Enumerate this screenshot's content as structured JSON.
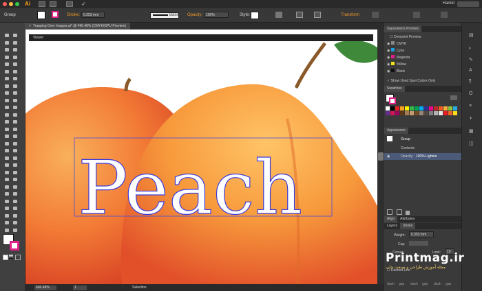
{
  "app": {
    "logo_text": "Ai",
    "user_name": "Hamid"
  },
  "control_bar": {
    "selection_label": "Group",
    "stroke_label": "Stroke:",
    "stroke_value": "0.353 mm",
    "brush_label": "Basic",
    "opacity_label": "Opacity:",
    "opacity_value": "100%",
    "style_label": "Style:",
    "transform_label": "Transform"
  },
  "document": {
    "tab_title": "Trapping Over Images.ai* @ 496.48% (CMYK/GPU Preview)",
    "viewer_label": "Viewer",
    "artwork_text": "Peach"
  },
  "status_bar": {
    "zoom": "496.48%",
    "page": "1",
    "tool": "Selection"
  },
  "separations": {
    "title": "Separations Preview",
    "overprint_label": "Overprint Preview",
    "plates": [
      {
        "name": "CMYK",
        "color": "#888888"
      },
      {
        "name": "Cyan",
        "color": "#1ea0e0"
      },
      {
        "name": "Magenta",
        "color": "#e0208a"
      },
      {
        "name": "Yellow",
        "color": "#f2e21a"
      },
      {
        "name": "Black",
        "color": "#111111"
      }
    ],
    "spot_label": "Show Used Spot Colors Only"
  },
  "swatches": {
    "title": "Swatches",
    "colors": [
      "#ffffff",
      "#000000",
      "#e31e24",
      "#f7a21b",
      "#fff200",
      "#39b54a",
      "#00a651",
      "#00aeef",
      "#2e3192",
      "#ec008c",
      "#c1272d",
      "#f15a24",
      "#fbb03b",
      "#8cc63f",
      "#29abe2",
      "#662d91",
      "#d4145a",
      "#9e005d",
      "#603813",
      "#a67c52",
      "#c69c6d",
      "#754c24",
      "#998675",
      "#534741",
      "#808080",
      "#b3b3b3",
      "#e6e6e6",
      "#ed1c24",
      "#f26522",
      "#ffde17"
    ]
  },
  "appearance": {
    "title": "Appearance",
    "object_label": "Group",
    "contents_label": "Contents",
    "opacity_text": "Opacity:",
    "opacity_value": "100% Lighten"
  },
  "align": {
    "tabs": [
      "Align",
      "Attributes"
    ]
  },
  "stroke_panel": {
    "tabs": [
      "Layers",
      "Stroke"
    ],
    "weight_label": "Weight:",
    "weight_value": "0.353 mm",
    "cap_label": "Cap:",
    "corner_label": "Corner:",
    "limit_label": "Limit:",
    "limit_value": "10",
    "dashed_label": "Dashed Line",
    "dash_labels": [
      "dash",
      "gap",
      "dash",
      "gap",
      "dash",
      "gap"
    ]
  },
  "watermark": {
    "brand": "Printmag.ir",
    "tagline": "مجله آموزش طراحی و صنعت چاپ"
  }
}
